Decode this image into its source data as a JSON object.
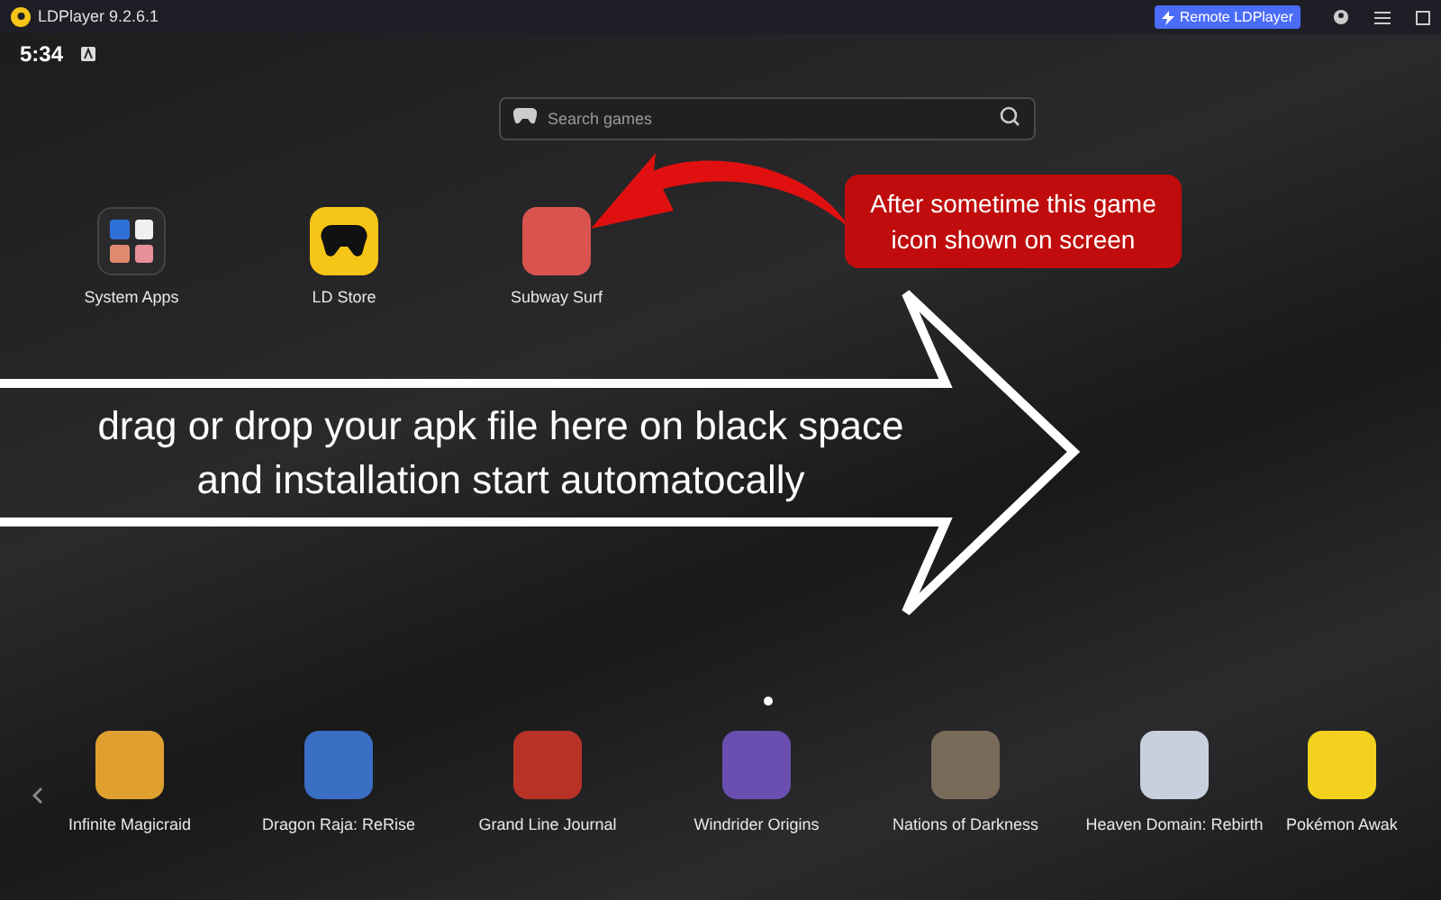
{
  "window": {
    "title": "LDPlayer 9.2.6.1",
    "remote_button": "Remote LDPlayer"
  },
  "status_bar": {
    "time": "5:34"
  },
  "search": {
    "placeholder": "Search games"
  },
  "desktop_apps": [
    {
      "label": "System Apps",
      "kind": "folder"
    },
    {
      "label": "LD Store",
      "kind": "store"
    },
    {
      "label": "Subway Surf",
      "kind": "game",
      "color": "#d9534f"
    }
  ],
  "annotation": {
    "callout": "After sometime this game icon shown on screen",
    "instruction": "drag or drop your apk file  here on black space and installation start automatocally"
  },
  "page_dots": [
    {
      "selected": true
    }
  ],
  "recommended_games": [
    {
      "label": "Infinite Magicraid",
      "color": "#e0a030"
    },
    {
      "label": "Dragon Raja: ReRise",
      "color": "#3b6fc4"
    },
    {
      "label": "Grand Line Journal",
      "color": "#b83228"
    },
    {
      "label": "Windrider Origins",
      "color": "#6a4fb0"
    },
    {
      "label": "Nations of Darkness",
      "color": "#7a6a5a"
    },
    {
      "label": "Heaven Domain: Rebirth",
      "color": "#c8d0e0"
    },
    {
      "label": "Pokémon Awak",
      "color": "#f2d21e"
    }
  ]
}
